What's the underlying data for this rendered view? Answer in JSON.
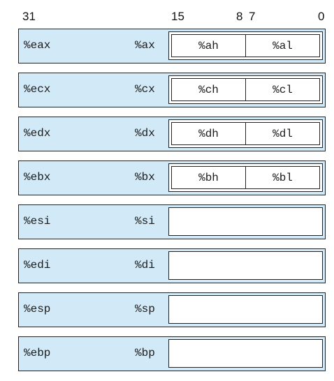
{
  "bit_positions": {
    "b31": "31",
    "b15": "15",
    "b8": "8",
    "b7": "7",
    "b0": "0"
  },
  "registers": [
    {
      "reg32": "%eax",
      "reg16": "%ax",
      "reg8_high": "%ah",
      "reg8_low": "%al"
    },
    {
      "reg32": "%ecx",
      "reg16": "%cx",
      "reg8_high": "%ch",
      "reg8_low": "%cl"
    },
    {
      "reg32": "%edx",
      "reg16": "%dx",
      "reg8_high": "%dh",
      "reg8_low": "%dl"
    },
    {
      "reg32": "%ebx",
      "reg16": "%bx",
      "reg8_high": "%bh",
      "reg8_low": "%bl"
    },
    {
      "reg32": "%esi",
      "reg16": "%si"
    },
    {
      "reg32": "%edi",
      "reg16": "%di"
    },
    {
      "reg32": "%esp",
      "reg16": "%sp"
    },
    {
      "reg32": "%ebp",
      "reg16": "%bp"
    }
  ]
}
